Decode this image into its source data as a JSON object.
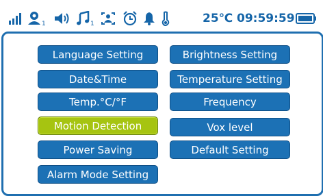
{
  "status_bar": {
    "icons": [
      "signal-icon",
      "camera-user-icon",
      "speaker-icon",
      "music-icon",
      "camera-switch-icon",
      "alarm-clock-icon",
      "bell-icon",
      "thermometer-icon",
      "battery-icon"
    ],
    "camera_sub": "1",
    "music_sub": "1",
    "temperature": "25℃",
    "time": "09:59:59",
    "battery_level": 1.0
  },
  "menu": {
    "selected": "Motion Detection",
    "left": [
      "Language Setting",
      "Date&Time",
      "Temp.°C/°F",
      "Motion Detection",
      "Power Saving",
      "Alarm Mode Setting"
    ],
    "right": [
      "Brightness Setting",
      "Temperature Setting",
      "Frequency",
      "Vox level",
      "Default Setting"
    ]
  },
  "colors": {
    "accent": "#1565a8",
    "button": "#1c71b5",
    "selected": "#a6c411"
  }
}
